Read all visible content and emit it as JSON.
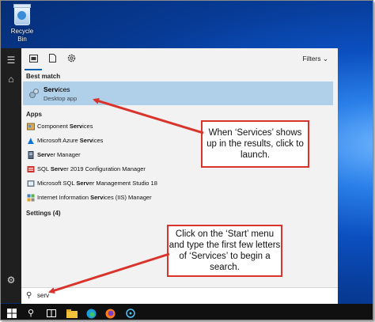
{
  "desktop": {
    "recycle_bin_label": "Recycle Bin"
  },
  "topbar": {
    "filters_label": "Filters",
    "filters_icon": "chevron-down-icon"
  },
  "sections": {
    "best_match": "Best match",
    "apps": "Apps",
    "settings": "Settings (4)"
  },
  "best_match": {
    "title_bold": "Serv",
    "title_rest": "ices",
    "subtitle": "Desktop app"
  },
  "apps": [
    {
      "pre": "Component ",
      "bold": "Serv",
      "post": "ices",
      "icon": "component-services-icon"
    },
    {
      "pre": "Microsoft Azure ",
      "bold": "Serv",
      "post": "ices",
      "icon": "azure-icon"
    },
    {
      "pre": "",
      "bold": "Serv",
      "post": "er Manager",
      "icon": "server-manager-icon"
    },
    {
      "pre": "SQL ",
      "bold": "Serv",
      "post": "er 2019 Configuration Manager",
      "icon": "sql-config-icon"
    },
    {
      "pre": "Microsoft SQL ",
      "bold": "Serv",
      "post": "er Management Studio 18",
      "icon": "ssms-icon"
    },
    {
      "pre": "Internet Information ",
      "bold": "Serv",
      "post": "ices (IIS) Manager",
      "icon": "iis-icon"
    }
  ],
  "search": {
    "value": "serv"
  },
  "callouts": {
    "services": "When ‘Services’ shows up in the results, click to launch.",
    "start": "Click on the ‘Start’ menu and type the first few letters of ‘Services’ to begin a search."
  },
  "colors": {
    "highlight": "#b0cfe9",
    "callout_border": "#d9342b",
    "accent": "#0063b1"
  }
}
